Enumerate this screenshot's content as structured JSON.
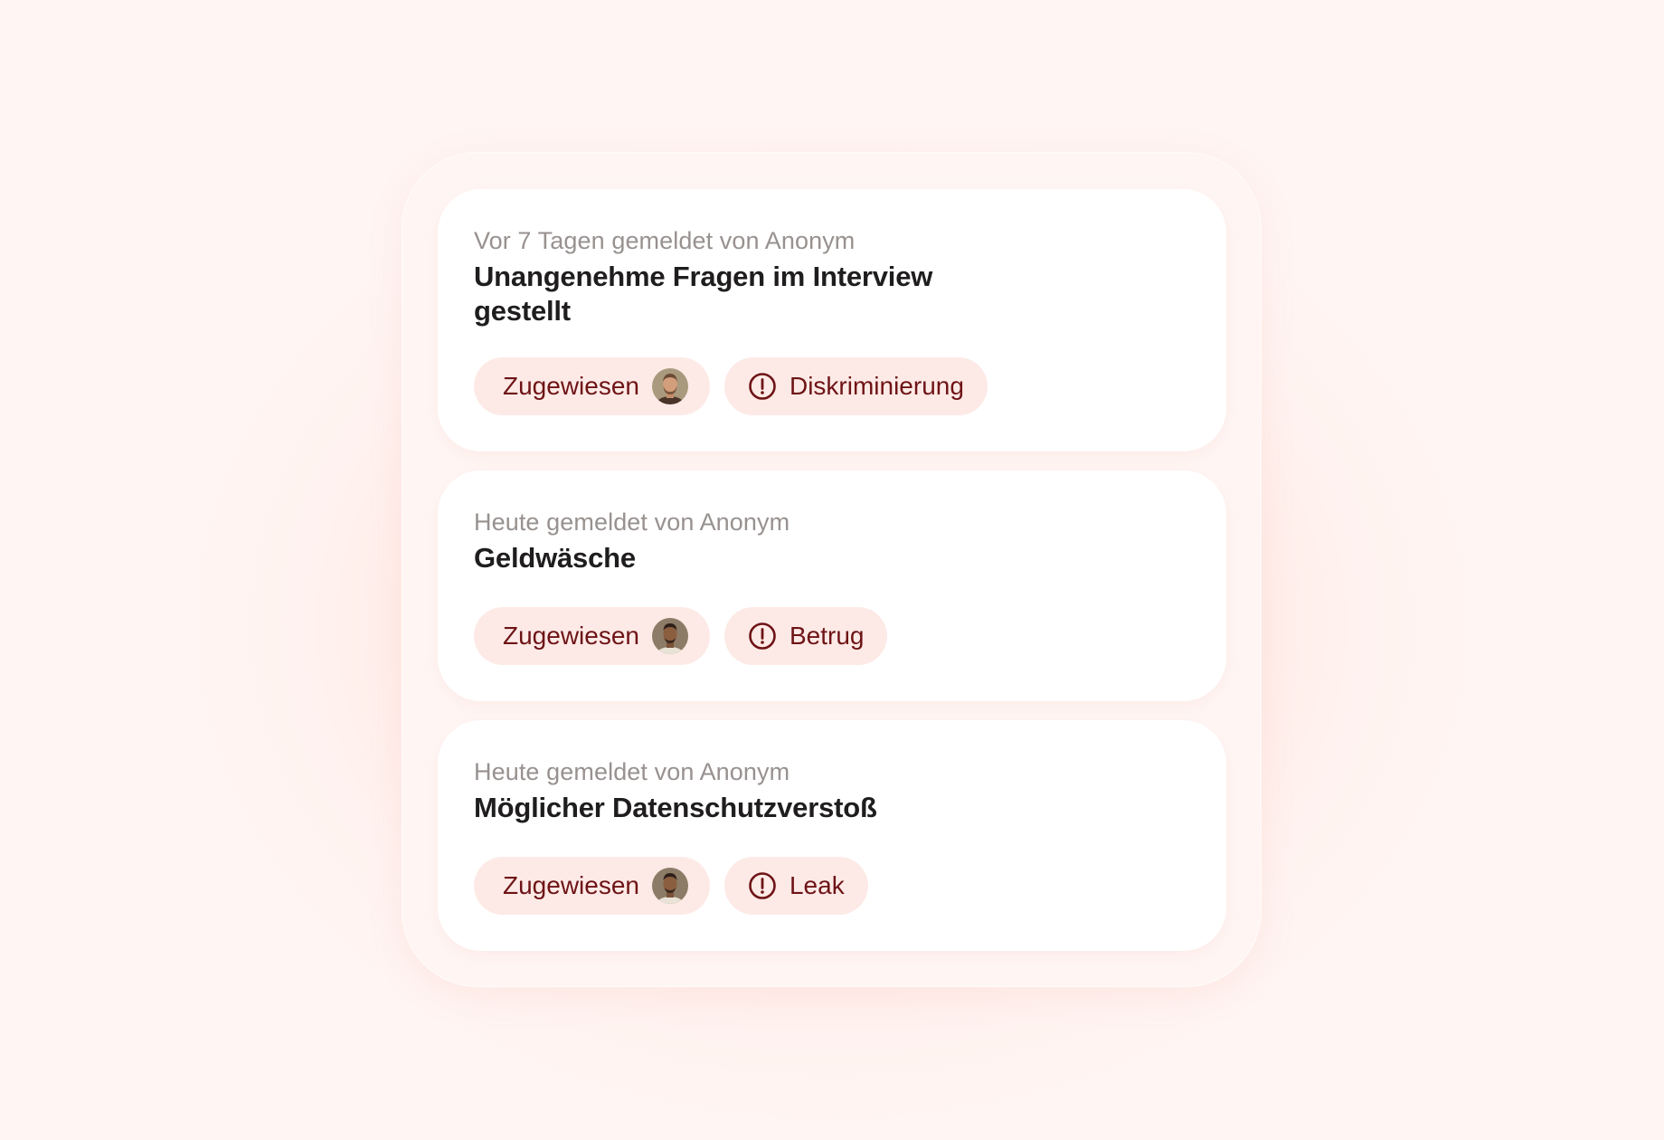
{
  "colors": {
    "background": "#fff2ef",
    "pill_background": "#fdeae6",
    "pill_text": "#6e1316",
    "meta_text": "#97918f",
    "title_text": "#1f1d1d"
  },
  "reports": [
    {
      "meta": "Vor 7 Tagen gemeldet von Anonym",
      "title": "Unangenehme Fragen im Interview gestellt",
      "status_label": "Zugewiesen",
      "assignee_icon": "avatar-bearded-man",
      "category_icon": "alert-circle-icon",
      "category": "Diskriminierung"
    },
    {
      "meta": "Heute gemeldet von Anonym",
      "title": "Geldwäsche",
      "status_label": "Zugewiesen",
      "assignee_icon": "avatar-man",
      "category_icon": "alert-circle-icon",
      "category": "Betrug"
    },
    {
      "meta": "Heute gemeldet von Anonym",
      "title": "Möglicher Datenschutzverstoß",
      "status_label": "Zugewiesen",
      "assignee_icon": "avatar-man",
      "category_icon": "alert-circle-icon",
      "category": "Leak"
    }
  ]
}
